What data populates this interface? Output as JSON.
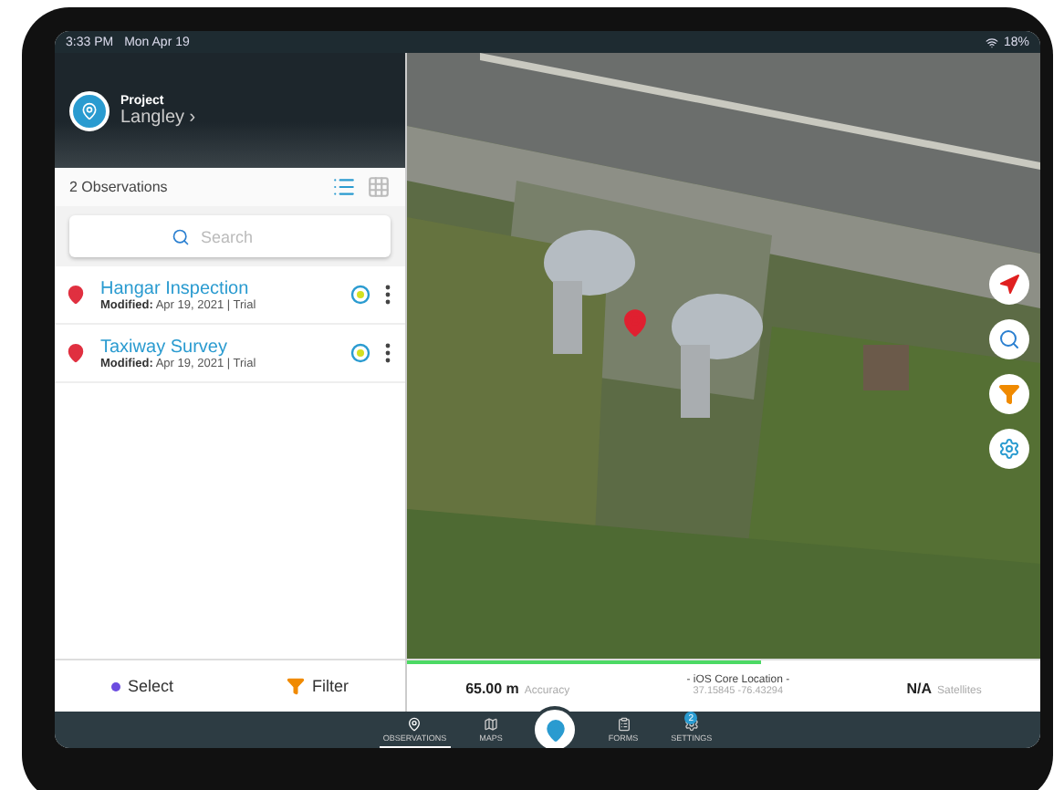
{
  "status_bar": {
    "time": "3:33 PM",
    "date": "Mon Apr 19",
    "battery": "18%"
  },
  "project": {
    "label": "Project",
    "name": "Langley ›"
  },
  "observations": {
    "count": "2 Observations",
    "views": [
      {
        "kind": "list",
        "selected": true
      },
      {
        "kind": "grid",
        "selected": false
      }
    ]
  },
  "search": {
    "placeholder": "Search"
  },
  "items": [
    {
      "title": "Hangar Inspection",
      "modified_label": "Modified:",
      "modified": "Apr 19, 2021 | Trial"
    },
    {
      "title": "Taxiway Survey",
      "modified_label": "Modified:",
      "modified": "Apr 19, 2021 | Trial"
    }
  ],
  "map": {
    "buttons": [
      {
        "kind": "locate"
      },
      {
        "kind": "search"
      },
      {
        "kind": "filter"
      },
      {
        "kind": "settings"
      }
    ]
  },
  "left_actions": {
    "select": "Select",
    "filter": "Filter"
  },
  "gps": {
    "level": 0.56,
    "accuracy_value": "65.00 m",
    "accuracy_label": "Accuracy",
    "source": "- iOS Core Location -",
    "coords": "37.15845 -76.43294",
    "satellites_value": "N/A",
    "satellites_label": "Satellites"
  },
  "tabs": [
    {
      "kind": "observations",
      "label": "OBSERVATIONS",
      "selected": true
    },
    {
      "kind": "maps",
      "label": "MAPS",
      "selected": false
    },
    {
      "kind": "add",
      "selected": false
    },
    {
      "kind": "forms",
      "label": "FORMS",
      "selected": false
    },
    {
      "kind": "settings",
      "label": "SETTINGS",
      "selected": false,
      "badge": "2"
    }
  ]
}
